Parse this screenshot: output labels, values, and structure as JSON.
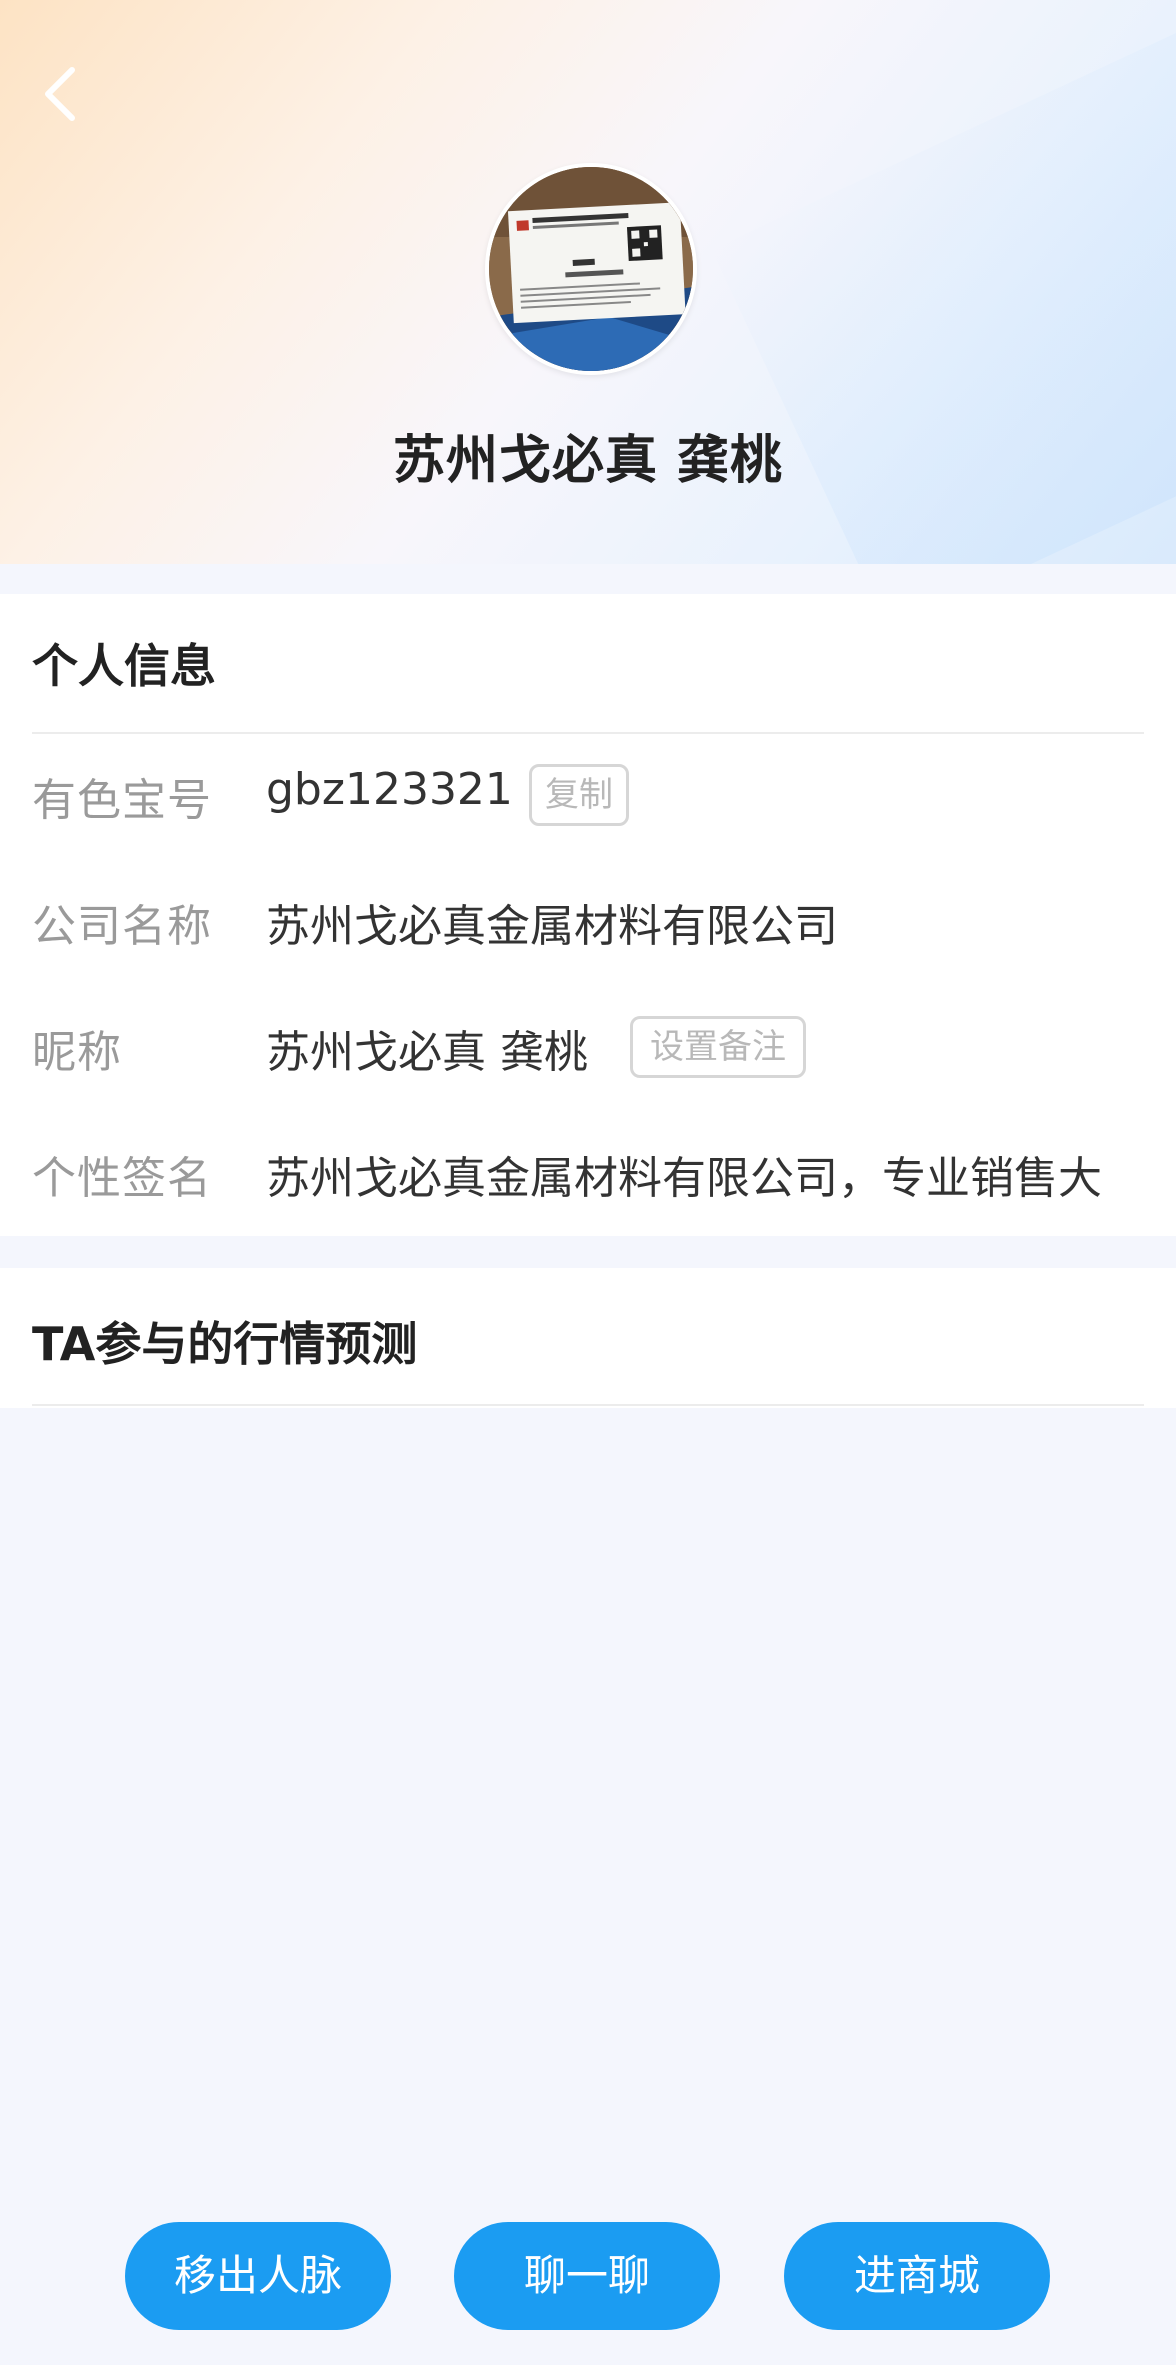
{
  "profile": {
    "name": "苏州戈必真 龚桃"
  },
  "avatar_card": {
    "company": "苏州戈必真金属材料有限公司",
    "company_en": "Suzhou GBZ Metal Material Co.,Ltd.",
    "person": "龚桃",
    "mobile": "Mobile: 151 5150 2018"
  },
  "personal_info": {
    "title": "个人信息",
    "rows": [
      {
        "label": "有色宝号",
        "value": "gbz123321",
        "action": "复制"
      },
      {
        "label": "公司名称",
        "value": "苏州戈必真金属材料有限公司"
      },
      {
        "label": "昵称",
        "value": "苏州戈必真 龚桃",
        "action": "设置备注"
      },
      {
        "label": "个性签名",
        "value": "苏州戈必真金属材料有限公司，专业销售大"
      }
    ]
  },
  "forecast": {
    "title": "TA参与的行情预测"
  },
  "actions": {
    "remove": "移出人脉",
    "chat": "聊一聊",
    "mall": "进商城"
  },
  "colors": {
    "accent": "#1b9cf2",
    "label_gray": "#9a9a9a",
    "background": "#f4f6fd"
  },
  "icons": [
    "back-arrow-icon"
  ]
}
